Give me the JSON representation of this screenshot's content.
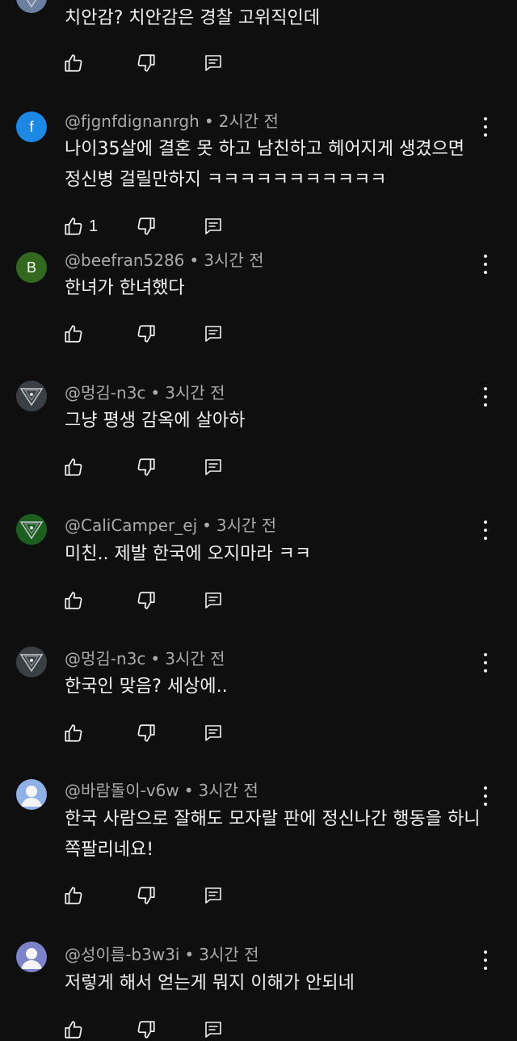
{
  "comments": [
    {
      "author": "",
      "time": "",
      "text": "치안감? 치안감은 경찰 고위직인데",
      "likes": "",
      "avatar": {
        "type": "image",
        "color": "#6b7fa0"
      }
    },
    {
      "author": "@fjgnfdignanrgh",
      "time": "2시간 전",
      "text": "나이35살에 결혼 못 하고 남친하고 헤어지게 생겼으면 정신병 걸릴만하지 ㅋㅋㅋㅋㅋㅋㅋㅋㅋㅋㅋ",
      "likes": "1",
      "avatar": {
        "type": "letter",
        "letter": "f",
        "color": "#1e88e5"
      }
    },
    {
      "author": "@beefran5286",
      "time": "3시간 전",
      "text": "한녀가 한녀했다",
      "likes": "",
      "avatar": {
        "type": "letter",
        "letter": "B",
        "color": "#33691e"
      }
    },
    {
      "author": "@멍김-n3c",
      "time": "3시간 전",
      "text": "그냥 평생 감옥에 살아하",
      "likes": "",
      "avatar": {
        "type": "image",
        "color": "#3a3f44"
      }
    },
    {
      "author": "@CaliCamper_ej",
      "time": "3시간 전",
      "text": "미친.. 제발 한국에 오지마라 ㅋㅋ",
      "likes": "",
      "avatar": {
        "type": "image",
        "color": "#1b5e20"
      }
    },
    {
      "author": "@멍김-n3c",
      "time": "3시간 전",
      "text": "한국인 맞음? 세상에..",
      "likes": "",
      "avatar": {
        "type": "image",
        "color": "#3a3f44"
      }
    },
    {
      "author": "@바람돌이-v6w",
      "time": "3시간 전",
      "text": "한국 사람으로 잘해도 모자랄 판에 정신나간 행동을 하니 쪽팔리네요!",
      "likes": "",
      "avatar": {
        "type": "default",
        "color": "#8fb1e8"
      }
    },
    {
      "author": "@성이름-b3w3i",
      "time": "3시간 전",
      "text": "저렇게 해서 얻는게 뭐지 이해가 안되네",
      "likes": "",
      "avatar": {
        "type": "default",
        "color": "#7d83c9"
      }
    }
  ],
  "icons": {
    "like": "thumbs-up-icon",
    "dislike": "thumbs-down-icon",
    "reply": "reply-comment-icon",
    "more": "more-vert-icon"
  },
  "colors": {
    "background": "#0f0f0f",
    "text": "#f1f1f1",
    "meta": "#aaaaaa"
  }
}
